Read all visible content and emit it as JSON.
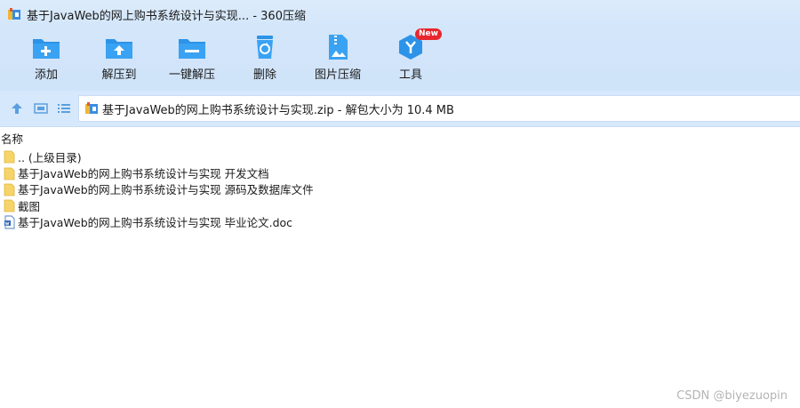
{
  "window": {
    "title": "基于JavaWeb的网上购书系统设计与实现... - 360压缩"
  },
  "toolbar": {
    "buttons": [
      {
        "label": "添加",
        "icon": "add-folder-icon"
      },
      {
        "label": "解压到",
        "icon": "extract-to-icon"
      },
      {
        "label": "一键解压",
        "icon": "one-click-extract-icon"
      },
      {
        "label": "删除",
        "icon": "recycle-bin-icon"
      },
      {
        "label": "图片压缩",
        "icon": "image-compress-icon"
      },
      {
        "label": "工具",
        "icon": "tools-icon",
        "badge": "New"
      }
    ]
  },
  "nav": {
    "address": "基于JavaWeb的网上购书系统设计与实现.zip - 解包大小为 10.4 MB"
  },
  "list": {
    "header": "名称",
    "rows": [
      {
        "name": ".. (上级目录)",
        "type": "folder"
      },
      {
        "name": "基于JavaWeb的网上购书系统设计与实现 开发文档",
        "type": "folder"
      },
      {
        "name": "基于JavaWeb的网上购书系统设计与实现 源码及数据库文件",
        "type": "folder"
      },
      {
        "name": "截图",
        "type": "folder"
      },
      {
        "name": "基于JavaWeb的网上购书系统设计与实现 毕业论文.doc",
        "type": "doc"
      }
    ]
  },
  "watermark": "CSDN @biyezuopin",
  "colors": {
    "accent": "#2c93e8",
    "toolbar_bg": "#d4e6fa",
    "badge": "#e8262d"
  }
}
